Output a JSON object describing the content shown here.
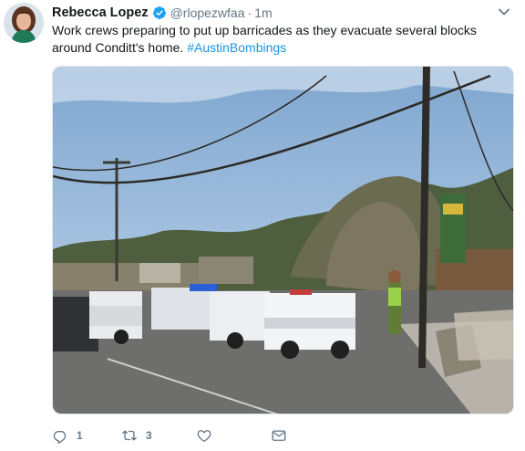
{
  "tweet": {
    "author": {
      "name": "Rebecca Lopez",
      "handle": "@rlopezwfaa",
      "verified": true
    },
    "separator": "·",
    "time": "1m",
    "text": "Work crews preparing to put up barricades as they evacuate several blocks around Conditt's home.",
    "hashtag": "#AustinBombings",
    "media": {
      "icon": "photo"
    },
    "actions": {
      "reply_count": "1",
      "retweet_count": "3",
      "like_count": "",
      "dm_count": ""
    }
  },
  "colors": {
    "text": "#14171a",
    "secondary": "#657786",
    "link": "#1b95e0",
    "verified": "#1da1f2"
  }
}
